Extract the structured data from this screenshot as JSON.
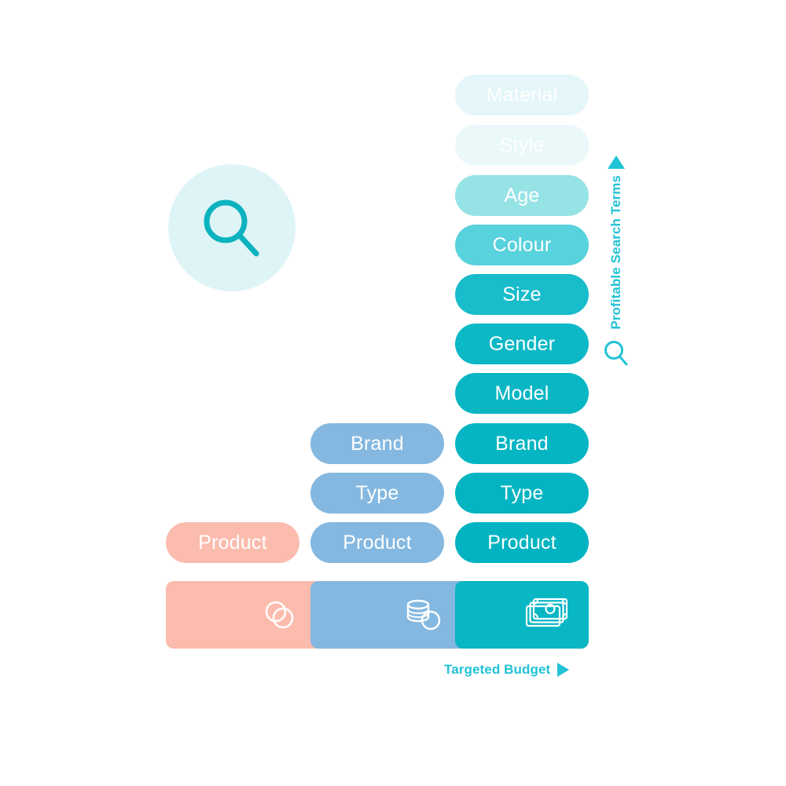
{
  "diagram": {
    "search_icon": "search-icon",
    "terms_axis": {
      "label": "Profitable Search Terms",
      "arrow_icon": "triangle-up-icon",
      "glass_icon": "search-icon"
    },
    "budget_axis": {
      "label": "Targeted Budget",
      "arrow_icon": "triangle-right-icon"
    },
    "columns": [
      {
        "name": "low-budget",
        "color": "#fbbcae",
        "pills": [
          {
            "label": "Product",
            "color": "#fbbcae"
          }
        ]
      },
      {
        "name": "mid-budget",
        "color": "#84b8e0",
        "pills": [
          {
            "label": "Brand",
            "color": "#84b8e0"
          },
          {
            "label": "Type",
            "color": "#84b8e0"
          },
          {
            "label": "Product",
            "color": "#84b8e0"
          }
        ]
      },
      {
        "name": "high-budget",
        "color": "#08b6c4",
        "pills": [
          {
            "label": "Material",
            "color": "#e4f6f9"
          },
          {
            "label": "Style",
            "color": "#eaf8fa"
          },
          {
            "label": "Age",
            "color": "#96e3e6"
          },
          {
            "label": "Colour",
            "color": "#58d2dc"
          },
          {
            "label": "Size",
            "color": "#18bccb"
          },
          {
            "label": "Gender",
            "color": "#0cb8c5"
          },
          {
            "label": "Model",
            "color": "#08b6c4"
          },
          {
            "label": "Brand",
            "color": "#06b5c3"
          },
          {
            "label": "Type",
            "color": "#04b4c2"
          },
          {
            "label": "Product",
            "color": "#02b3c1"
          }
        ]
      }
    ],
    "budget_bar": [
      {
        "name": "coins-pair",
        "color": "#fbbcae",
        "icon": "two-coins-icon"
      },
      {
        "name": "coin-stack",
        "color": "#84b8e0",
        "icon": "coin-stack-icon"
      },
      {
        "name": "banknotes",
        "color": "#08b6c4",
        "icon": "banknotes-icon"
      }
    ]
  }
}
